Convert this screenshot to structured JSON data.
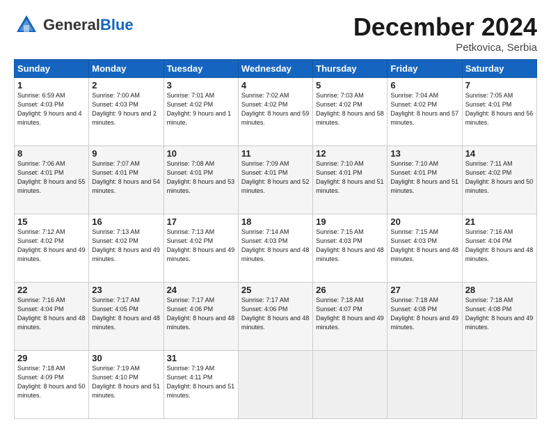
{
  "header": {
    "logo_general": "General",
    "logo_blue": "Blue",
    "month": "December 2024",
    "location": "Petkovica, Serbia"
  },
  "days_of_week": [
    "Sunday",
    "Monday",
    "Tuesday",
    "Wednesday",
    "Thursday",
    "Friday",
    "Saturday"
  ],
  "weeks": [
    [
      {
        "day": 1,
        "sunrise": "6:59 AM",
        "sunset": "4:03 PM",
        "daylight": "9 hours and 4 minutes."
      },
      {
        "day": 2,
        "sunrise": "7:00 AM",
        "sunset": "4:03 PM",
        "daylight": "9 hours and 2 minutes."
      },
      {
        "day": 3,
        "sunrise": "7:01 AM",
        "sunset": "4:02 PM",
        "daylight": "9 hours and 1 minute."
      },
      {
        "day": 4,
        "sunrise": "7:02 AM",
        "sunset": "4:02 PM",
        "daylight": "8 hours and 59 minutes."
      },
      {
        "day": 5,
        "sunrise": "7:03 AM",
        "sunset": "4:02 PM",
        "daylight": "8 hours and 58 minutes."
      },
      {
        "day": 6,
        "sunrise": "7:04 AM",
        "sunset": "4:02 PM",
        "daylight": "8 hours and 57 minutes."
      },
      {
        "day": 7,
        "sunrise": "7:05 AM",
        "sunset": "4:01 PM",
        "daylight": "8 hours and 56 minutes."
      }
    ],
    [
      {
        "day": 8,
        "sunrise": "7:06 AM",
        "sunset": "4:01 PM",
        "daylight": "8 hours and 55 minutes."
      },
      {
        "day": 9,
        "sunrise": "7:07 AM",
        "sunset": "4:01 PM",
        "daylight": "8 hours and 54 minutes."
      },
      {
        "day": 10,
        "sunrise": "7:08 AM",
        "sunset": "4:01 PM",
        "daylight": "8 hours and 53 minutes."
      },
      {
        "day": 11,
        "sunrise": "7:09 AM",
        "sunset": "4:01 PM",
        "daylight": "8 hours and 52 minutes."
      },
      {
        "day": 12,
        "sunrise": "7:10 AM",
        "sunset": "4:01 PM",
        "daylight": "8 hours and 51 minutes."
      },
      {
        "day": 13,
        "sunrise": "7:10 AM",
        "sunset": "4:01 PM",
        "daylight": "8 hours and 51 minutes."
      },
      {
        "day": 14,
        "sunrise": "7:11 AM",
        "sunset": "4:02 PM",
        "daylight": "8 hours and 50 minutes."
      }
    ],
    [
      {
        "day": 15,
        "sunrise": "7:12 AM",
        "sunset": "4:02 PM",
        "daylight": "8 hours and 49 minutes."
      },
      {
        "day": 16,
        "sunrise": "7:13 AM",
        "sunset": "4:02 PM",
        "daylight": "8 hours and 49 minutes."
      },
      {
        "day": 17,
        "sunrise": "7:13 AM",
        "sunset": "4:02 PM",
        "daylight": "8 hours and 49 minutes."
      },
      {
        "day": 18,
        "sunrise": "7:14 AM",
        "sunset": "4:03 PM",
        "daylight": "8 hours and 48 minutes."
      },
      {
        "day": 19,
        "sunrise": "7:15 AM",
        "sunset": "4:03 PM",
        "daylight": "8 hours and 48 minutes."
      },
      {
        "day": 20,
        "sunrise": "7:15 AM",
        "sunset": "4:03 PM",
        "daylight": "8 hours and 48 minutes."
      },
      {
        "day": 21,
        "sunrise": "7:16 AM",
        "sunset": "4:04 PM",
        "daylight": "8 hours and 48 minutes."
      }
    ],
    [
      {
        "day": 22,
        "sunrise": "7:16 AM",
        "sunset": "4:04 PM",
        "daylight": "8 hours and 48 minutes."
      },
      {
        "day": 23,
        "sunrise": "7:17 AM",
        "sunset": "4:05 PM",
        "daylight": "8 hours and 48 minutes."
      },
      {
        "day": 24,
        "sunrise": "7:17 AM",
        "sunset": "4:06 PM",
        "daylight": "8 hours and 48 minutes."
      },
      {
        "day": 25,
        "sunrise": "7:17 AM",
        "sunset": "4:06 PM",
        "daylight": "8 hours and 48 minutes."
      },
      {
        "day": 26,
        "sunrise": "7:18 AM",
        "sunset": "4:07 PM",
        "daylight": "8 hours and 49 minutes."
      },
      {
        "day": 27,
        "sunrise": "7:18 AM",
        "sunset": "4:08 PM",
        "daylight": "8 hours and 49 minutes."
      },
      {
        "day": 28,
        "sunrise": "7:18 AM",
        "sunset": "4:08 PM",
        "daylight": "8 hours and 49 minutes."
      }
    ],
    [
      {
        "day": 29,
        "sunrise": "7:18 AM",
        "sunset": "4:09 PM",
        "daylight": "8 hours and 50 minutes."
      },
      {
        "day": 30,
        "sunrise": "7:19 AM",
        "sunset": "4:10 PM",
        "daylight": "8 hours and 51 minutes."
      },
      {
        "day": 31,
        "sunrise": "7:19 AM",
        "sunset": "4:11 PM",
        "daylight": "8 hours and 51 minutes."
      },
      null,
      null,
      null,
      null
    ]
  ]
}
